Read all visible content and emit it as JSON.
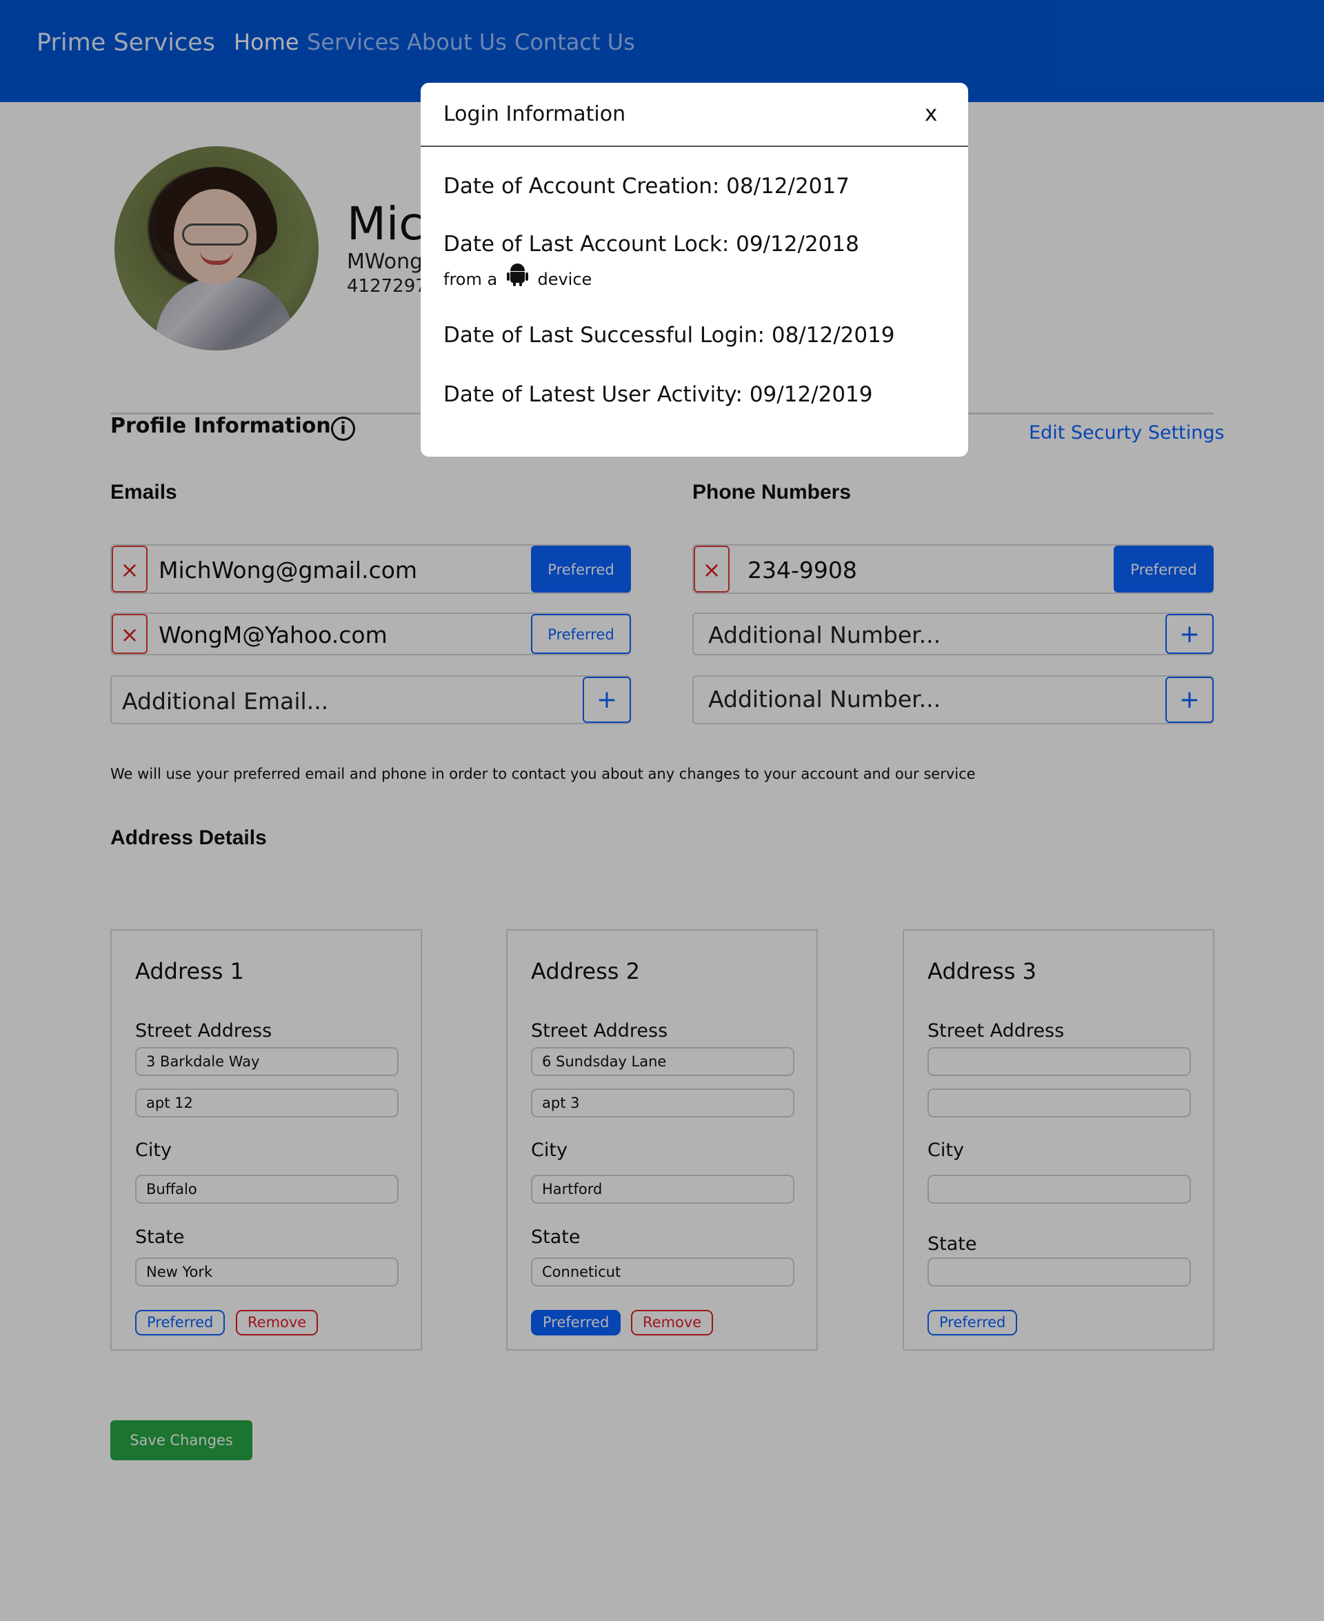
{
  "header": {
    "brand": "Prime Services",
    "nav": [
      "Home",
      "Services",
      "About Us",
      "Contact Us"
    ],
    "active": "Home"
  },
  "profile": {
    "name": "Mic",
    "username": "MWong",
    "phone": "4127297"
  },
  "profile_info": {
    "heading": "Profile Information",
    "info_icon": "i",
    "edit_link": "Edit Securty Settings"
  },
  "emails": {
    "title": "Emails",
    "items": [
      {
        "value": "MichWong@gmail.com",
        "preferred_label": "Preferred",
        "preferred": true
      },
      {
        "value": "WongM@Yahoo.com",
        "preferred_label": "Preferred",
        "preferred": false
      }
    ],
    "add_placeholder": "Additional Email...",
    "remove_glyph": "×",
    "add_glyph": "+"
  },
  "phones": {
    "title": "Phone Numbers",
    "items": [
      {
        "value": "234-9908",
        "preferred_label": "Preferred",
        "preferred": true
      }
    ],
    "add_placeholders": [
      "Additional Number...",
      "Additional Number..."
    ],
    "remove_glyph": "×",
    "add_glyph": "+"
  },
  "note": "We will use your preferred email and phone in order to contact you about any changes to your account and our service",
  "address": {
    "title": "Address Details",
    "cards": [
      {
        "title": "Address 1",
        "street_label": "Street Address",
        "street1": "3 Barkdale Way",
        "street2": "apt 12",
        "city_label": "City",
        "city": "Buffalo",
        "state_label": "State",
        "state": "New York",
        "preferred_label": "Preferred",
        "remove_label": "Remove"
      },
      {
        "title": "Address 2",
        "street_label": "Street Address",
        "street1": "6 Sundsday Lane",
        "street2": "apt 3",
        "city_label": "City",
        "city": "Hartford",
        "state_label": "State",
        "state": "Conneticut",
        "preferred_label": "Preferred",
        "remove_label": "Remove"
      },
      {
        "title": "Address 3",
        "street_label": "Street Address",
        "street1": "",
        "street2": "",
        "city_label": "City",
        "city": "",
        "state_label": "State",
        "state": "",
        "preferred_label": "Preferred"
      }
    ]
  },
  "save_label": "Save Changes",
  "modal": {
    "title": "Login Information",
    "close": "x",
    "creation": "Date of Account Creation: 08/12/2017",
    "last_lock": "Date of Last Account Lock: 09/12/2018",
    "device_prefix": "from a",
    "device_suffix": "device",
    "device_icon": "android-icon",
    "last_login": "Date of Last Successful Login: 08/12/2019",
    "latest_activity": "Date of Latest User Activity: 09/12/2019"
  },
  "colors": {
    "navbar": "#0057d6",
    "accent": "#0b63ff",
    "danger": "#e01f2a",
    "success": "#28a745",
    "overlay": "rgba(0,0,0,0.3)"
  }
}
